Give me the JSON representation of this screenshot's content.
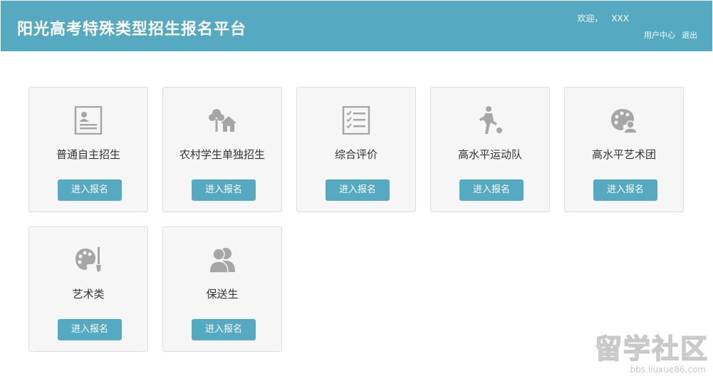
{
  "header": {
    "title": "阳光高考特殊类型招生报名平台",
    "welcome_label": "欢迎，",
    "username": "XXX",
    "user_center": "用户中心",
    "logout": "退出"
  },
  "cards": [
    {
      "label": "普通自主招生",
      "button": "进入报名",
      "icon": "resume-icon"
    },
    {
      "label": "农村学生单独招生",
      "button": "进入报名",
      "icon": "tree-house-icon"
    },
    {
      "label": "综合评价",
      "button": "进入报名",
      "icon": "checklist-icon"
    },
    {
      "label": "高水平运动队",
      "button": "进入报名",
      "icon": "soccer-player-icon"
    },
    {
      "label": "高水平艺术团",
      "button": "进入报名",
      "icon": "palette-group-icon"
    },
    {
      "label": "艺术类",
      "button": "进入报名",
      "icon": "palette-brush-icon"
    },
    {
      "label": "保送生",
      "button": "进入报名",
      "icon": "users-icon"
    }
  ],
  "watermark": {
    "text": "留学社区",
    "url": "bbs.liuxue86.com"
  },
  "colors": {
    "primary": "#55a9c0",
    "card_bg": "#f6f6f6",
    "icon": "#a6a6a6"
  }
}
